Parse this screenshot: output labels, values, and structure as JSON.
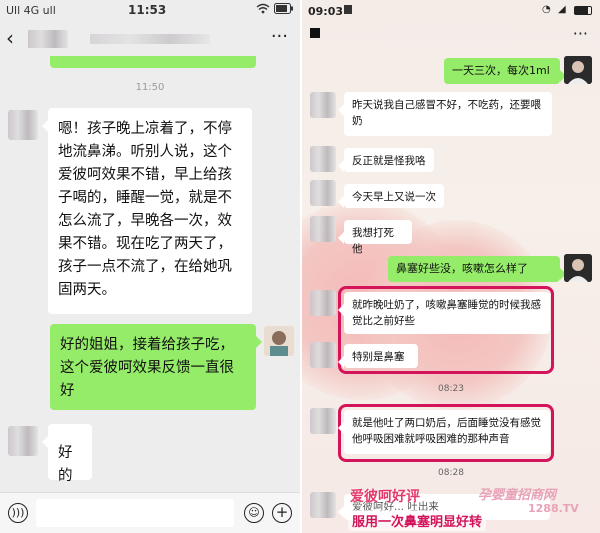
{
  "left": {
    "status": {
      "carrier": "Ull 4G ull",
      "time": "11:53",
      "wifi_icon": "wifi-icon",
      "battery_icon": "battery-icon"
    },
    "nav": {
      "back": "‹",
      "menu": "···"
    },
    "timestamp": "11:50",
    "messages": [
      {
        "side": "left",
        "text": "嗯！孩子晚上凉着了，不停地流鼻涕。听别人说，这个爱彼呵效果不错，早上给孩子喝的，睡醒一觉，就是不怎么流了，早晚各一次，效果不错。现在吃了两天了，孩子一点不流了，在给她巩固两天。"
      },
      {
        "side": "right",
        "text": "好的姐姐，接着给孩子吃，这个爱彼呵效果反馈一直很好"
      },
      {
        "side": "left",
        "text": "好的"
      }
    ],
    "input": {
      "voice_icon": "voice-icon",
      "emoji_icon": "emoji-icon",
      "plus_icon": "plus-icon"
    }
  },
  "right": {
    "status": {
      "time": "09:03"
    },
    "nav": {
      "menu": "···"
    },
    "messages": [
      {
        "side": "right",
        "text": "一天三次，每次1ml"
      },
      {
        "side": "left",
        "text": "昨天说我自己感冒不好，不吃药，还要喂奶"
      },
      {
        "side": "left",
        "text": "反正就是怪我咯"
      },
      {
        "side": "left",
        "text": "今天早上又说一次"
      },
      {
        "side": "left",
        "text": "我想打死他"
      },
      {
        "side": "right",
        "text": "鼻塞好些没，咳嗽怎么样了"
      },
      {
        "side": "left",
        "text": "就昨晚吐奶了，咳嗽鼻塞睡觉的时候我感觉比之前好些"
      },
      {
        "side": "left",
        "text": "特别是鼻塞"
      },
      {
        "side": "left",
        "text": "就是他吐了两口奶后，后面睡觉没有感觉他呼吸困难就呼吸困难的那种声音"
      },
      {
        "side": "left",
        "text": "爱彼呵好... 吐出来"
      }
    ],
    "timestamps": [
      "08:23",
      "08:28"
    ],
    "watermark": {
      "brand": "爱彼呵好评",
      "site_cn": "孕婴童招商网",
      "site_url": "1288.TV",
      "caption": "服用一次鼻塞明显好转"
    },
    "highlight_color": "#d4145a"
  }
}
